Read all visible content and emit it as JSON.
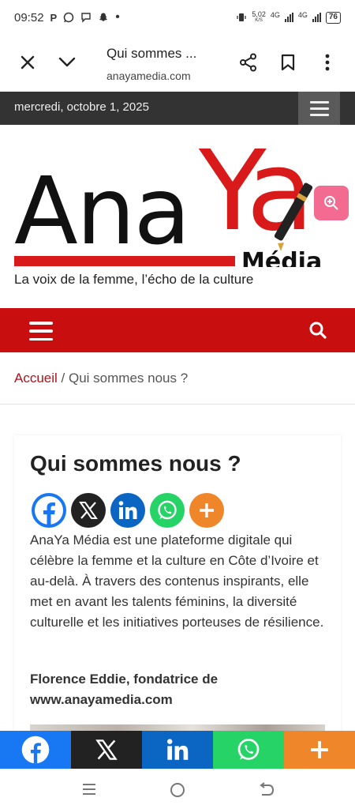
{
  "status_bar": {
    "time": "09:52",
    "notif_icons": [
      "P",
      "whatsapp-icon",
      "chat-icon",
      "snapchat-icon",
      "•"
    ],
    "net_speed_value": "5,02",
    "net_speed_unit": "K/S",
    "sim1_label": "4G",
    "sim2_label": "4G",
    "battery": "76"
  },
  "browser": {
    "title": "Qui sommes ...",
    "url": "anayamedia.com"
  },
  "top_bar": {
    "date": "mercredi, octobre 1, 2025"
  },
  "logo": {
    "ana": "Ana",
    "ya": "Ya",
    "media": "Média",
    "tagline": "La voix de la femme, l’écho de la culture"
  },
  "breadcrumb": {
    "home": "Accueil",
    "separator": " / ",
    "current": "Qui sommes nous ?"
  },
  "article": {
    "title": "Qui sommes nous ?",
    "body": "AnaYa Média est une plateforme digitale qui célèbre la femme et la culture en Côte d’Ivoire et au-delà. À travers des contenus inspirants, elle met en avant les talents féminins, la diversité culturelle et les initiatives porteuses de résilience.",
    "signature_line1": "Florence Eddie, fondatrice de",
    "signature_line2": "www.anayamedia.com"
  },
  "share_buttons": [
    "facebook",
    "x",
    "linkedin",
    "whatsapp",
    "more"
  ],
  "colors": {
    "brand_red": "#c80e0e",
    "date_bar": "#333333",
    "facebook": "#1877f2",
    "x": "#222222",
    "linkedin": "#0a66c2",
    "whatsapp": "#25d366",
    "more": "#f0862a"
  }
}
